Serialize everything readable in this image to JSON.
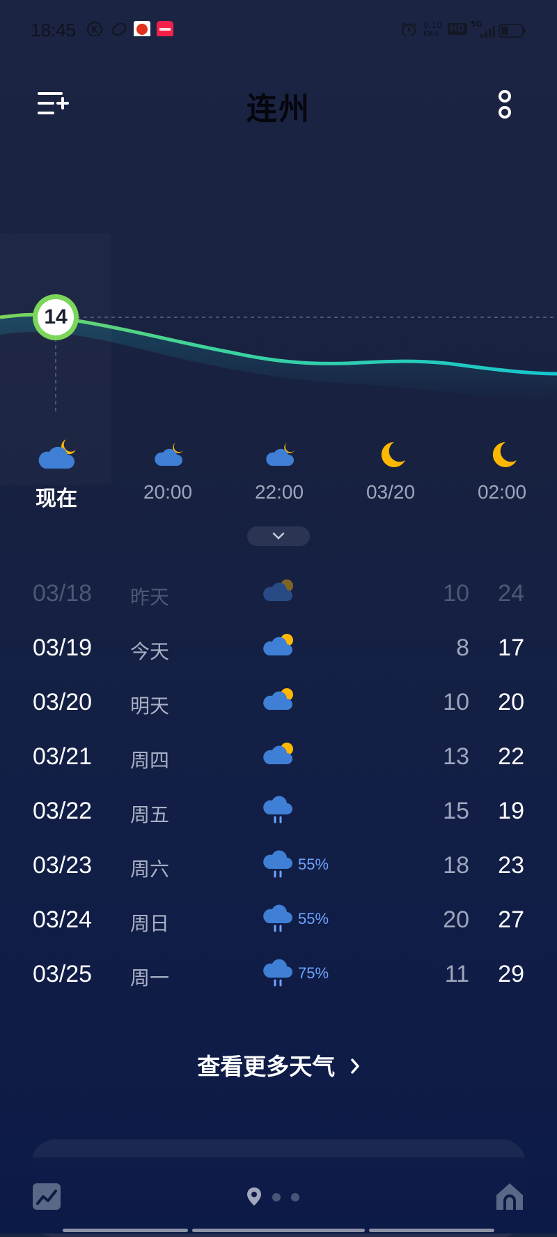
{
  "status_bar": {
    "time": "18:45",
    "speed_value": "0.10",
    "speed_unit": "KB/s",
    "hd": "HD",
    "network": "5G"
  },
  "header": {
    "city": "连州"
  },
  "current": {
    "temp": "14"
  },
  "hourly": [
    {
      "label": "现在",
      "icon": "cloud-moon-icon"
    },
    {
      "label": "20:00",
      "icon": "cloud-moon-icon"
    },
    {
      "label": "22:00",
      "icon": "cloud-moon-icon"
    },
    {
      "label": "03/20",
      "icon": "moon-icon"
    },
    {
      "label": "02:00",
      "icon": "moon-icon"
    }
  ],
  "daily": [
    {
      "date": "03/18",
      "weekday": "昨天",
      "icon": "cloud-sun-icon",
      "precip": "",
      "low": "10",
      "high": "24"
    },
    {
      "date": "03/19",
      "weekday": "今天",
      "icon": "cloud-sun-icon",
      "precip": "",
      "low": "8",
      "high": "17"
    },
    {
      "date": "03/20",
      "weekday": "明天",
      "icon": "cloud-sun-icon",
      "precip": "",
      "low": "10",
      "high": "20"
    },
    {
      "date": "03/21",
      "weekday": "周四",
      "icon": "cloud-sun-icon",
      "precip": "",
      "low": "13",
      "high": "22"
    },
    {
      "date": "03/22",
      "weekday": "周五",
      "icon": "rain-icon",
      "precip": "",
      "low": "15",
      "high": "19"
    },
    {
      "date": "03/23",
      "weekday": "周六",
      "icon": "rain-icon",
      "precip": "55%",
      "low": "18",
      "high": "23"
    },
    {
      "date": "03/24",
      "weekday": "周日",
      "icon": "rain-icon",
      "precip": "55%",
      "low": "20",
      "high": "27"
    },
    {
      "date": "03/25",
      "weekday": "周一",
      "icon": "rain-icon",
      "precip": "75%",
      "low": "11",
      "high": "29"
    }
  ],
  "more_link": "查看更多天气",
  "colors": {
    "curve_start": "#7bd65a",
    "curve_end": "#16c6cf",
    "moon": "#ffb800",
    "cloud": "#3f7fd6",
    "precip": "#6ea4ff"
  }
}
